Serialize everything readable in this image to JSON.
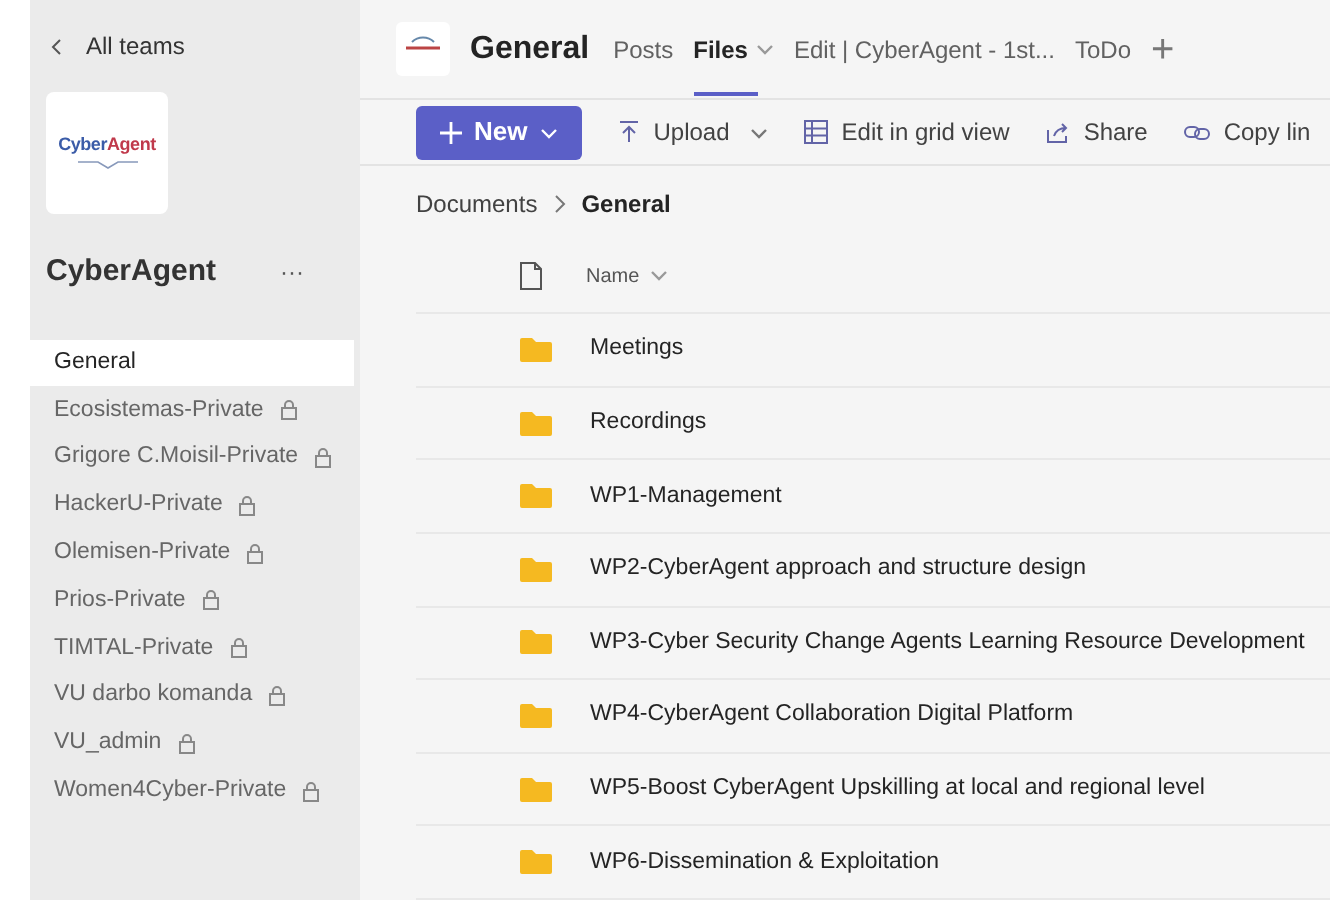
{
  "sidebar": {
    "back_link": "All teams",
    "logo": {
      "part_1": "Cyber",
      "part_2": "Agent"
    },
    "team_name": "CyberAgent",
    "more": "···",
    "channels": [
      {
        "name": "General",
        "selected": true,
        "private": false
      },
      {
        "name": "Ecosistemas-Private",
        "selected": false,
        "private": true
      },
      {
        "name": "Grigore C.Moisil-Private",
        "selected": false,
        "private": true
      },
      {
        "name": "HackerU-Private",
        "selected": false,
        "private": true
      },
      {
        "name": "Olemisen-Private",
        "selected": false,
        "private": true
      },
      {
        "name": "Prios-Private",
        "selected": false,
        "private": true
      },
      {
        "name": "TIMTAL-Private",
        "selected": false,
        "private": true
      },
      {
        "name": "VU darbo komanda",
        "selected": false,
        "private": true
      },
      {
        "name": "VU_admin",
        "selected": false,
        "private": true
      },
      {
        "name": "Women4Cyber-Private",
        "selected": false,
        "private": true
      }
    ]
  },
  "header": {
    "channel": "General",
    "tabs": [
      {
        "label": "Posts",
        "selected": false,
        "dropdown": false
      },
      {
        "label": "Files",
        "selected": true,
        "dropdown": true
      },
      {
        "label": "Edit | CyberAgent - 1st...",
        "selected": false,
        "dropdown": false
      },
      {
        "label": "ToDo",
        "selected": false,
        "dropdown": false
      }
    ],
    "add": "+"
  },
  "toolbar": {
    "new_button": "New",
    "actions": [
      {
        "kind": "upload",
        "label": "Upload",
        "dropdown": true
      },
      {
        "kind": "grid",
        "label": "Edit in grid view",
        "dropdown": false
      },
      {
        "kind": "share",
        "label": "Share",
        "dropdown": false
      },
      {
        "kind": "link",
        "label": "Copy lin",
        "dropdown": false
      }
    ]
  },
  "breadcrumb": [
    "Documents",
    "General"
  ],
  "files": {
    "columns": [
      "Name"
    ],
    "rows": [
      {
        "name": "Meetings"
      },
      {
        "name": "Recordings"
      },
      {
        "name": "WP1-Management"
      },
      {
        "name": "WP2-CyberAgent approach and structure design"
      },
      {
        "name": "WP3-Cyber Security Change Agents Learning Resource Development"
      },
      {
        "name": "WP4-CyberAgent Collaboration Digital Platform"
      },
      {
        "name": "WP5-Boost CyberAgent Upskilling at local and regional level"
      },
      {
        "name": "WP6-Dissemination & Exploitation"
      }
    ]
  }
}
